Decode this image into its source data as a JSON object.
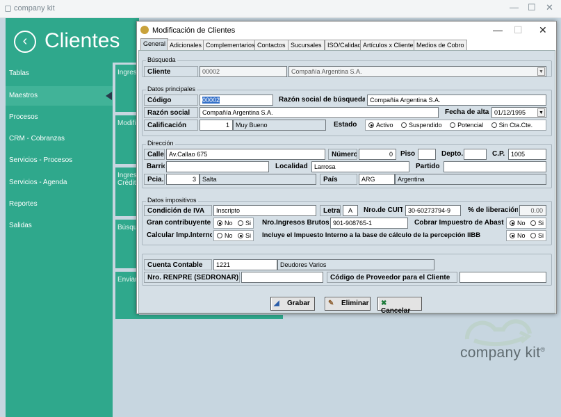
{
  "window": {
    "app_title": "company kit",
    "minimize": "—",
    "maximize": "☐",
    "close": "✕"
  },
  "header": {
    "title": "Clientes",
    "back_icon": "arrow-left-icon"
  },
  "sidebar": {
    "items": [
      {
        "label": "Tablas"
      },
      {
        "label": "Maestros"
      },
      {
        "label": "Procesos"
      },
      {
        "label": "CRM - Cobranzas"
      },
      {
        "label": "Servicios - Procesos"
      },
      {
        "label": "Servicios - Agenda"
      },
      {
        "label": "Reportes"
      },
      {
        "label": "Salidas"
      }
    ]
  },
  "tiles": [
    "Ingres",
    "Modifi",
    "Ingres\nCrédit",
    "Búsqued",
    "Enviar"
  ],
  "logo": {
    "text": "company kit",
    "mark": "®"
  },
  "dialog": {
    "title": "Modificación de Clientes",
    "tabs": [
      "General",
      "Adicionales",
      "Complementarios",
      "Contactos",
      "Sucursales",
      "ISO/Calidad",
      "Artículos x Cliente",
      "Medios de Cobro"
    ],
    "busqueda": {
      "group": "Búsqueda",
      "label": "Cliente",
      "code": "00002",
      "name": "Compañía Argentina S.A."
    },
    "principales": {
      "group": "Datos principales",
      "codigo_label": "Código",
      "codigo": "00002",
      "razon_busq_label": "Razón social de búsqueda",
      "razon_busq": "Compañía Argentina S.A.",
      "razon_label": "Razón social",
      "razon": "Compañía Argentina S.A.",
      "fecha_label": "Fecha de alta",
      "fecha": "01/12/1995",
      "calif_label": "Calificación",
      "calif_num": "1",
      "calif_text": "Muy Bueno",
      "estado_label": "Estado",
      "estado_options": [
        "Activo",
        "Suspendido",
        "Potencial",
        "Sin Cta.Cte."
      ],
      "estado_selected": "Activo"
    },
    "direccion": {
      "group": "Dirección",
      "calle_label": "Calle",
      "calle": "Av.Callao 675",
      "numero_label": "Número",
      "numero": "0",
      "piso_label": "Piso",
      "piso": "",
      "depto_label": "Depto.",
      "depto": "",
      "cp_label": "C.P.",
      "cp": "1005",
      "barrio_label": "Barrio",
      "barrio": "",
      "localidad_label": "Localidad",
      "localidad": "Larrosa",
      "partido_label": "Partido",
      "partido": "",
      "pcia_label": "Pcia.",
      "pcia_num": "3",
      "pcia_name": "Salta",
      "pais_label": "País",
      "pais_code": "ARG",
      "pais_name": "Argentina"
    },
    "impositivos": {
      "group": "Datos impositivos",
      "iva_label": "Condición de IVA",
      "iva": "Inscripto",
      "letra_label": "Letra",
      "letra": "A",
      "cuit_label": "Nro.de CUIT",
      "cuit": "30-60273794-9",
      "lib_label": "% de liberación",
      "lib": "0.00",
      "gran_label": "Gran contribuyente",
      "gran_options": [
        "No",
        "Si"
      ],
      "gran_selected": "No",
      "ingbrutos_label": "Nro.Ingresos Brutos",
      "ingbrutos": "901-908765-1",
      "abasto_label": "Cobrar Impuestro de Abasto",
      "abasto_options": [
        "No",
        "Si"
      ],
      "abasto_selected": "No",
      "impint_label": "Calcular Imp.Internos",
      "impint_options": [
        "No",
        "Si"
      ],
      "impint_selected": "Si",
      "incluye_label": "Incluye el Impuesto Interno a la base de cálculo de la percepción IIBB",
      "incluye_options": [
        "No",
        "Si"
      ],
      "incluye_selected": "No"
    },
    "contable": {
      "cuenta_label": "Cuenta Contable",
      "cuenta_num": "1221",
      "cuenta_name": "Deudores Varios",
      "renpre_label": "Nro. RENPRE (SEDRONAR)",
      "renpre": "",
      "prov_label": "Código de Proveedor para el Cliente",
      "prov": ""
    },
    "buttons": {
      "grabar": "Grabar",
      "eliminar": "Eliminar",
      "cancelar": "Cancelar"
    }
  }
}
